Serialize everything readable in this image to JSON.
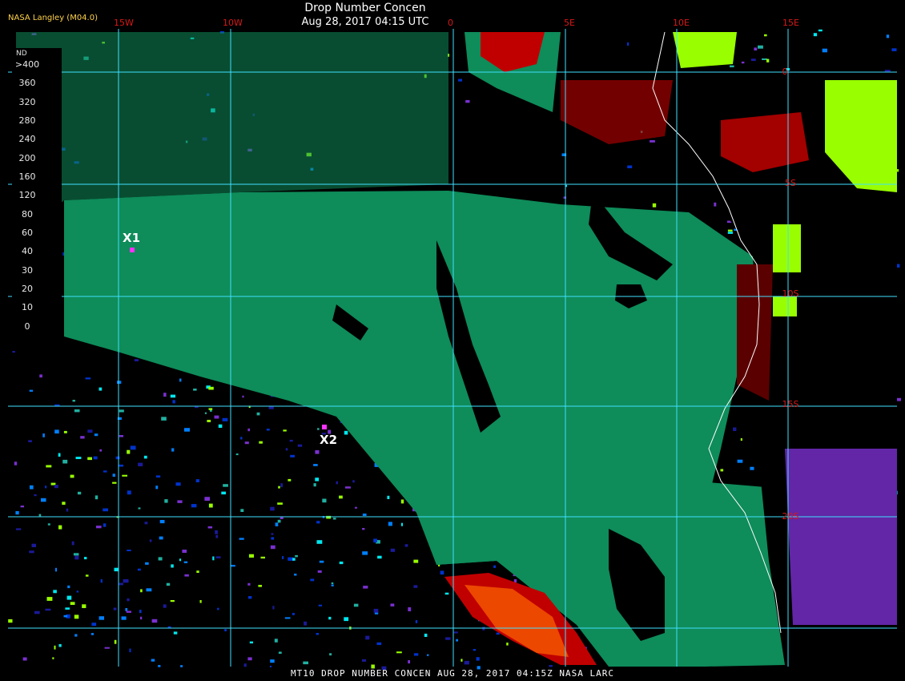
{
  "title": "Drop Number Concen",
  "subtitle": "Aug 28, 2017 04:15 UTC",
  "producer": "NASA Langley (M04.0)",
  "footer": "MT10  DROP NUMBER CONCEN   AUG 28, 2017 04:15Z   NASA LARC",
  "longitude_labels": [
    "15W",
    "10W",
    "0",
    "5E",
    "10E",
    "15E"
  ],
  "latitude_labels": [
    "0",
    "5S",
    "10S",
    "15S",
    "20S"
  ],
  "legend": {
    "unit": "ND",
    "labels": [
      ">400",
      "360",
      "320",
      "280",
      "240",
      "200",
      "160",
      "120",
      "80",
      "60",
      "40",
      "30",
      "20",
      "10",
      "0"
    ],
    "colors": [
      "#5a0000",
      "#c00000",
      "#ff2000",
      "#ff6600",
      "#ff9900",
      "#ffe600",
      "#99ff00",
      "#20c020",
      "#0e8c5a",
      "#20b0a0",
      "#00e8f0",
      "#0080ff",
      "#0033cc",
      "#1a1a9a",
      "#7a30d0"
    ]
  },
  "markers": [
    {
      "label": "X1"
    },
    {
      "label": "X2"
    }
  ],
  "palette": {
    "background": "#000000",
    "grid": "#40e0ff",
    "cloud": "#0e8c5a",
    "coast": "#ffffff",
    "marker": "#ff33ff"
  }
}
